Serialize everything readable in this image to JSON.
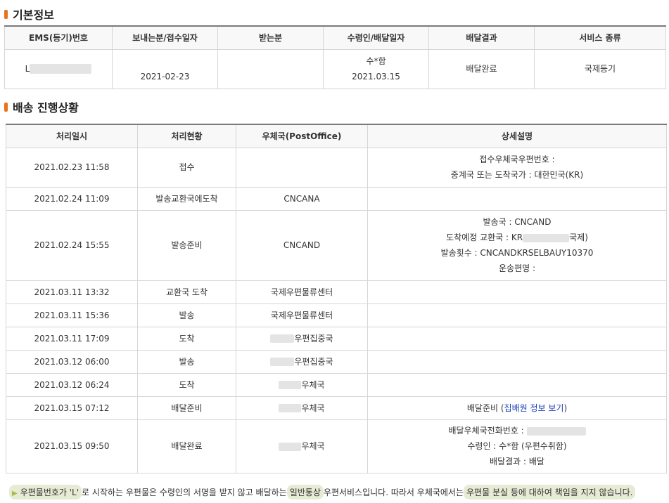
{
  "basic": {
    "title": "기본정보",
    "headers": [
      "EMS(등기)번호",
      "보내는분/접수일자",
      "받는분",
      "수령인/배달일자",
      "배달결과",
      "서비스 종류"
    ],
    "ems_prefix": "L",
    "accept_date": "2021-02-23",
    "receiver": "수*함",
    "delivery_date": "2021.03.15",
    "result": "배달완료",
    "service": "국제등기"
  },
  "tracking": {
    "title": "배송 진행상황",
    "headers": [
      "처리일시",
      "처리현황",
      "우체국(PostOffice)",
      "상세설명"
    ],
    "rows": [
      {
        "date": "2021.02.23 11:58",
        "status": "접수",
        "office": "",
        "detail1": "접수우체국우편번호 :",
        "detail2": "중계국 또는 도착국가 : 대한민국(KR)"
      },
      {
        "date": "2021.02.24 11:09",
        "status": "발송교환국에도착",
        "office": "CNCANA"
      },
      {
        "date": "2021.02.24 15:55",
        "status": "발송준비",
        "office": "CNCAND",
        "detail1": "발송국 : CNCAND",
        "detail2_prefix": "도착예정 교환국 : KR",
        "detail2_suffix": "국제)",
        "detail3": "발송횟수 : CNCANDKRSELBAUY10370",
        "detail4": "운송편명 :"
      },
      {
        "date": "2021.03.11 13:32",
        "status": "교환국 도착",
        "office": "국제우편물류센터"
      },
      {
        "date": "2021.03.11 15:36",
        "status": "발송",
        "office": "국제우편물류센터"
      },
      {
        "date": "2021.03.11 17:09",
        "status": "도착",
        "office": "우편집중국"
      },
      {
        "date": "2021.03.12 06:00",
        "status": "발송",
        "office": "우편집중국"
      },
      {
        "date": "2021.03.12 06:24",
        "status": "도착",
        "office": "우체국"
      },
      {
        "date": "2021.03.15 07:12",
        "status": "배달준비",
        "office": "우체국",
        "detail_text": "배달준비 (",
        "detail_link": "집배원 정보 보기",
        "detail_close": ")"
      },
      {
        "date": "2021.03.15 09:50",
        "status": "배달완료",
        "office": "우체국",
        "detail1": "배달우체국전화번호 :",
        "detail2": "수령인 : 수*함 (우편수취함)",
        "detail3": "배달결과 : 배달"
      }
    ]
  },
  "notice": {
    "part1": "우편물번호가 'L'",
    "part2": "로 시작하는 우편물은 수령인의 서명을 받지 않고 배달하는",
    "part3": "일반통상",
    "part4": "우편서비스입니다. 따라서 우체국에서는",
    "part5": "우편물 분실 등에 대하여 책임을 지지 않습니다."
  }
}
